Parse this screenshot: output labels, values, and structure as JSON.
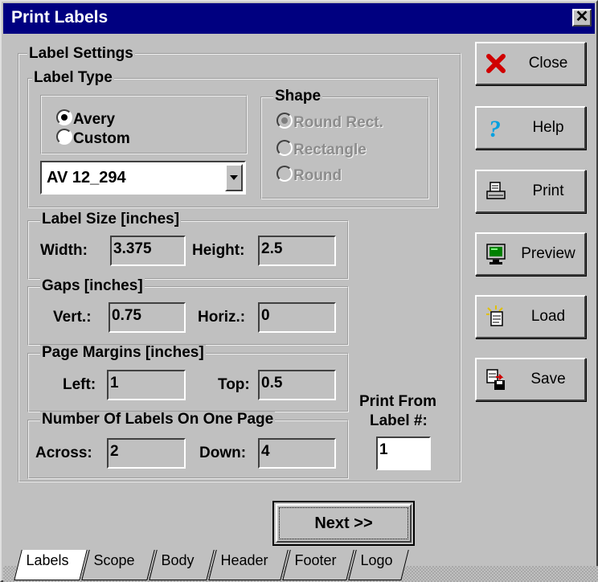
{
  "window": {
    "title": "Print Labels",
    "close_glyph": "✕"
  },
  "label_settings": {
    "title": "Label Settings",
    "label_type": {
      "title": "Label Type",
      "options": [
        {
          "label": "Avery",
          "checked": true
        },
        {
          "label": "Custom",
          "checked": false
        }
      ],
      "combo_value": "AV 12_294",
      "shape": {
        "title": "Shape",
        "options": [
          {
            "label": "Round Rect.",
            "checked": true
          },
          {
            "label": "Rectangle",
            "checked": false
          },
          {
            "label": "Round",
            "checked": false
          }
        ]
      }
    },
    "label_size": {
      "title": "Label Size [inches]",
      "width_label": "Width:",
      "width_value": "3.375",
      "height_label": "Height:",
      "height_value": "2.5"
    },
    "gaps": {
      "title": "Gaps [inches]",
      "vert_label": "Vert.:",
      "vert_value": "0.75",
      "horiz_label": "Horiz.:",
      "horiz_value": "0"
    },
    "margins": {
      "title": "Page Margins [inches]",
      "left_label": "Left:",
      "left_value": "1",
      "top_label": "Top:",
      "top_value": "0.5"
    },
    "count": {
      "title": "Number Of Labels On One Page",
      "across_label": "Across:",
      "across_value": "2",
      "down_label": "Down:",
      "down_value": "4"
    },
    "print_from": {
      "line1": "Print From",
      "line2": "Label #:",
      "value": "1"
    }
  },
  "side_buttons": [
    {
      "label": "Close",
      "icon": "red-x-icon"
    },
    {
      "label": "Help",
      "icon": "question-mark-icon"
    },
    {
      "label": "Print",
      "icon": "printer-icon"
    },
    {
      "label": "Preview",
      "icon": "monitor-icon"
    },
    {
      "label": "Load",
      "icon": "load-document-icon"
    },
    {
      "label": "Save",
      "icon": "save-document-icon"
    }
  ],
  "next_button": "Next >>",
  "tabs": [
    "Labels",
    "Scope",
    "Body",
    "Header",
    "Footer",
    "Logo"
  ],
  "colors": {
    "titlebar": "#000080",
    "face": "#c0c0c0",
    "close_x": "#dd0000",
    "help": "#00a0e0"
  }
}
